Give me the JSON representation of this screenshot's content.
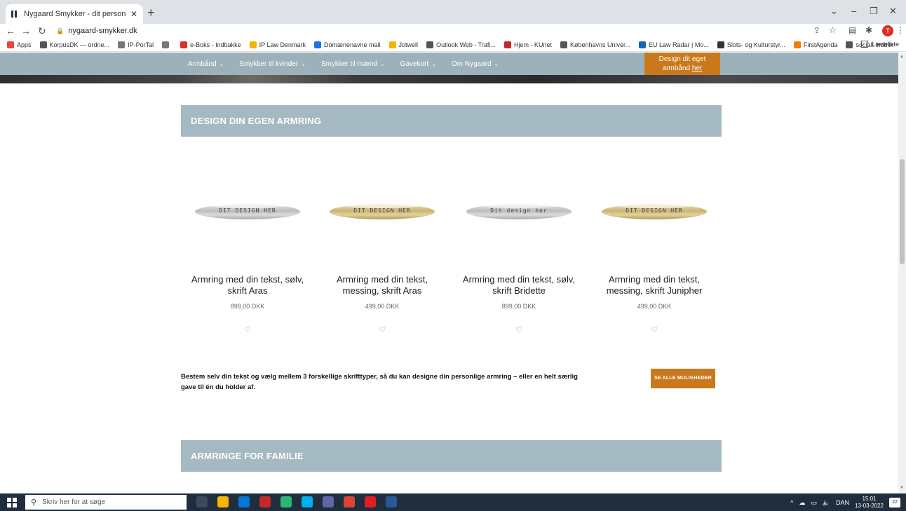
{
  "browser": {
    "tab_title": "Nygaard Smykker - dit personlig",
    "url": "nygaard-smykker.dk",
    "reading_list": "Læseliste",
    "profile_initial": "T",
    "bookmarks": [
      {
        "label": "Apps",
        "color": "#e8453c"
      },
      {
        "label": "KorpusDK — ordne...",
        "color": "#555"
      },
      {
        "label": "IP-PorTal",
        "color": "#777"
      },
      {
        "label": "",
        "color": "#777"
      },
      {
        "label": "e-Boks - Indbakke",
        "color": "#d93025"
      },
      {
        "label": "IP Law Denmark",
        "color": "#f4b400"
      },
      {
        "label": "Domænenavne mail",
        "color": "#1a73e8"
      },
      {
        "label": "Jotwell",
        "color": "#f4b400"
      },
      {
        "label": "Outlook Web - Trafi...",
        "color": "#555"
      },
      {
        "label": "Hjem - KUnet",
        "color": "#c62828"
      },
      {
        "label": "Københavns Univer...",
        "color": "#555"
      },
      {
        "label": "EU Law Radar | Mo...",
        "color": "#1565c0"
      },
      {
        "label": "Slots- og Kulturstyr...",
        "color": "#333"
      },
      {
        "label": "FirstAgenda",
        "color": "#f57c00"
      },
      {
        "label": "socialt indblik",
        "color": "#555"
      }
    ]
  },
  "site": {
    "nav": [
      {
        "label": "Armbånd"
      },
      {
        "label": "Smykker til kvinder"
      },
      {
        "label": "Smykker til mænd"
      },
      {
        "label": "Gavekort"
      },
      {
        "label": "Om Nygaard"
      }
    ],
    "cta_line1": "Design dit eget",
    "cta_line2": "armbånd",
    "cta_link": "her",
    "section1_title": "DESIGN DIN EGEN ARMRING",
    "section2_title": "ARMRINGE FOR FAMILIE",
    "products": [
      {
        "title": "Armring med din tekst, sølv, skrift Aras",
        "price": "899,00 DKK",
        "engraving": "DIT DESIGN HER",
        "material": "silver"
      },
      {
        "title": "Armring med din tekst, messing, skrift Aras",
        "price": "499,00 DKK",
        "engraving": "DIT DESIGN HER",
        "material": "brass"
      },
      {
        "title": "Armring med din tekst, sølv, skrift Bridette",
        "price": "899,00 DKK",
        "engraving": "Dit design her",
        "material": "silver"
      },
      {
        "title": "Armring med din tekst, messing, skrift Junipher",
        "price": "499,00 DKK",
        "engraving": "DIT DESIGN HER",
        "material": "brass"
      }
    ],
    "description": "Bestem selv din tekst og vælg mellem 3 forskellige skrifttyper, så du kan designe din personlige armring – eller en helt særlig gave til én du holder af.",
    "see_all_label": "SE ALLE MULIGHEDER"
  },
  "taskbar": {
    "search_placeholder": "Skriv her for at søge",
    "language": "DAN",
    "time": "15:01",
    "date": "13-03-2022",
    "notifications": "22"
  }
}
